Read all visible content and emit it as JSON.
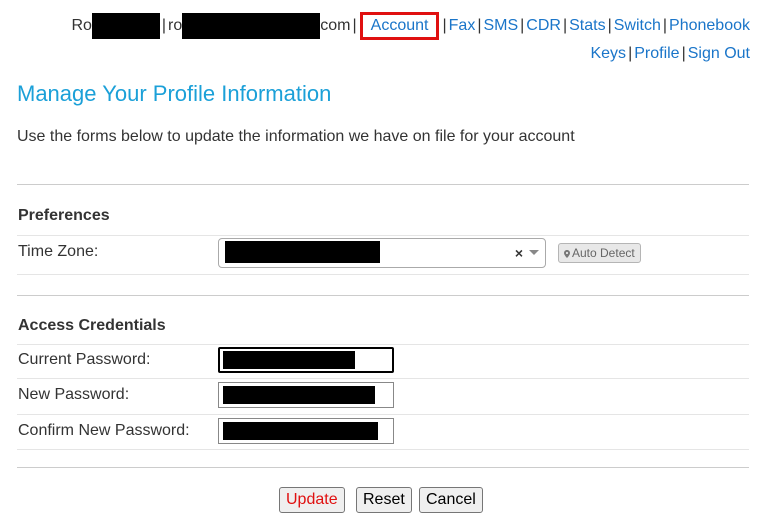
{
  "nav": {
    "user_name_prefix": "Ro",
    "user_email_prefix": "ro",
    "user_email_suffix": "com",
    "links": [
      "Account",
      "Fax",
      "SMS",
      "CDR",
      "Stats",
      "Switch",
      "Phonebook",
      "Keys",
      "Profile",
      "Sign Out"
    ],
    "highlighted": "Account"
  },
  "page": {
    "title": "Manage Your Profile Information",
    "intro": "Use the forms below to update the information we have on file for your account"
  },
  "preferences": {
    "heading": "Preferences",
    "timezone_label": "Time Zone:",
    "clear_symbol": "×",
    "auto_detect_label": "Auto Detect"
  },
  "credentials": {
    "heading": "Access Credentials",
    "current_password_label": "Current Password:",
    "new_password_label": "New Password:",
    "confirm_password_label": "Confirm New Password:"
  },
  "buttons": {
    "update": "Update",
    "reset": "Reset",
    "cancel": "Cancel"
  },
  "colors": {
    "link": "#1a75c9",
    "title": "#1ba0d8",
    "highlight_box": "#e01010",
    "update_text": "#e01010"
  }
}
